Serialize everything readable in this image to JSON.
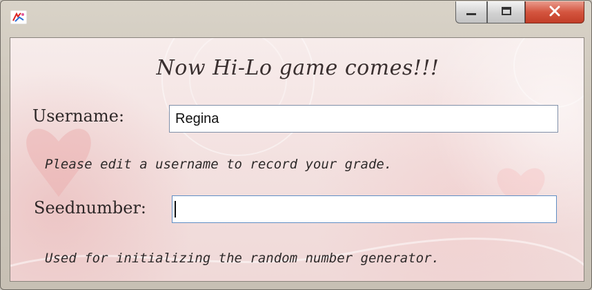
{
  "window": {
    "controls": {
      "minimize_icon": "minimize-icon",
      "maximize_icon": "maximize-icon",
      "close_icon": "close-icon"
    }
  },
  "form": {
    "title": "Now Hi-Lo game comes!!!",
    "username_label": "Username:",
    "username_value": "Regina",
    "username_hint": "Please edit a username to record your grade.",
    "seed_label": "Seednumber:",
    "seed_value": "",
    "seed_hint": "Used for initializing the random number generator."
  }
}
